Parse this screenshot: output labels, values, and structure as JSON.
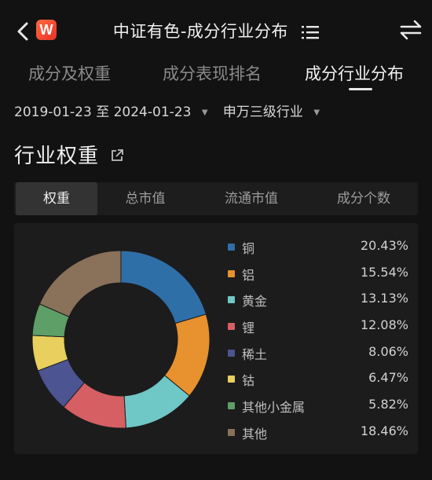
{
  "header": {
    "app_logo_text": "W",
    "title": "中证有色-成分行业分布"
  },
  "tabs": [
    {
      "label": "成分及权重",
      "active": false
    },
    {
      "label": "成分表现排名",
      "active": false
    },
    {
      "label": "成分行业分布",
      "active": true
    }
  ],
  "filters": {
    "date_range": "2019-01-23 至 2024-01-23",
    "classification": "申万三级行业"
  },
  "section": {
    "title": "行业权重"
  },
  "segments": [
    {
      "label": "权重",
      "active": true
    },
    {
      "label": "总市值",
      "active": false
    },
    {
      "label": "流通市值",
      "active": false
    },
    {
      "label": "成分个数",
      "active": false
    }
  ],
  "chart_data": {
    "type": "pie",
    "categories": [
      "铜",
      "铝",
      "黄金",
      "锂",
      "稀土",
      "钴",
      "其他小金属",
      "其他"
    ],
    "values": [
      20.43,
      15.54,
      13.13,
      12.08,
      8.06,
      6.47,
      5.82,
      18.46
    ],
    "labels": [
      "20.43%",
      "15.54%",
      "13.13%",
      "12.08%",
      "8.06%",
      "6.47%",
      "5.82%",
      "18.46%"
    ],
    "colors": [
      "#2f6fa8",
      "#e8912f",
      "#6fc7c6",
      "#d55f63",
      "#4c5492",
      "#e8cf5e",
      "#5d9f66",
      "#8a7159"
    ],
    "style": "donut",
    "legend_position": "right"
  }
}
